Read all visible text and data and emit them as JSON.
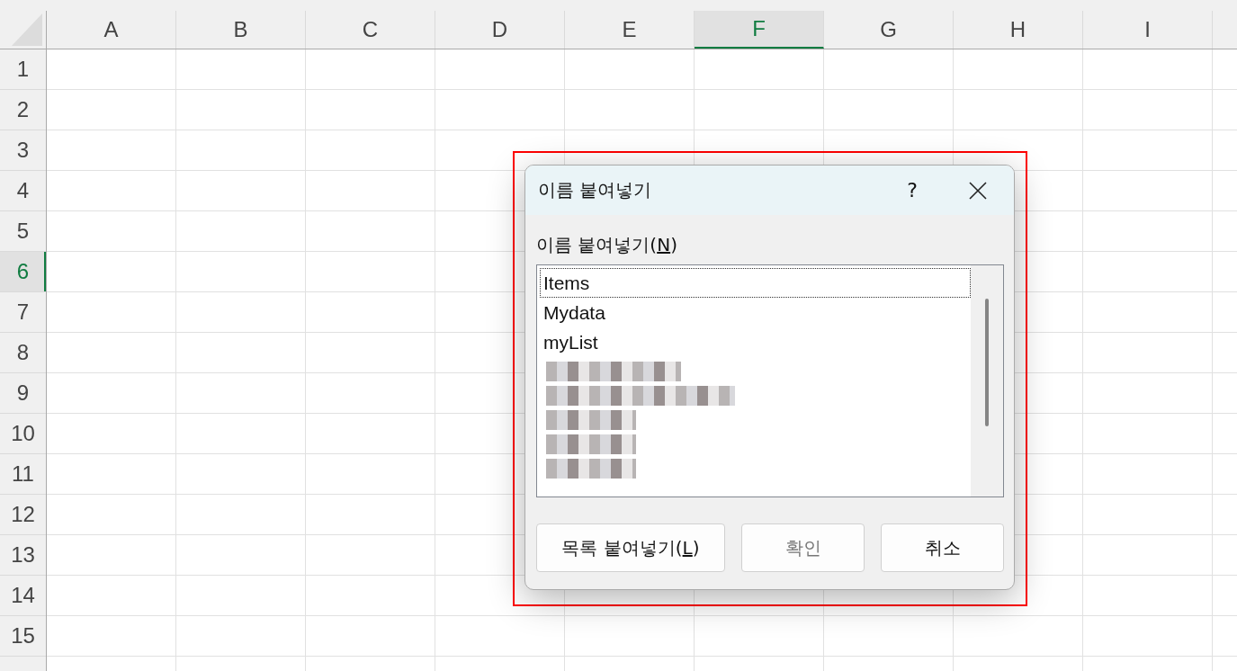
{
  "sheet": {
    "columns": [
      {
        "label": "A",
        "selected": false
      },
      {
        "label": "B",
        "selected": false
      },
      {
        "label": "C",
        "selected": false
      },
      {
        "label": "D",
        "selected": false
      },
      {
        "label": "E",
        "selected": false
      },
      {
        "label": "F",
        "selected": true
      },
      {
        "label": "G",
        "selected": false
      },
      {
        "label": "H",
        "selected": false
      },
      {
        "label": "I",
        "selected": false
      }
    ],
    "rows": [
      {
        "label": "1",
        "selected": false
      },
      {
        "label": "2",
        "selected": false
      },
      {
        "label": "3",
        "selected": false
      },
      {
        "label": "4",
        "selected": false
      },
      {
        "label": "5",
        "selected": false
      },
      {
        "label": "6",
        "selected": true
      },
      {
        "label": "7",
        "selected": false
      },
      {
        "label": "8",
        "selected": false
      },
      {
        "label": "9",
        "selected": false
      },
      {
        "label": "10",
        "selected": false
      },
      {
        "label": "11",
        "selected": false
      },
      {
        "label": "12",
        "selected": false
      },
      {
        "label": "13",
        "selected": false
      },
      {
        "label": "14",
        "selected": false
      },
      {
        "label": "15",
        "selected": false
      }
    ]
  },
  "dialog": {
    "title": "이름 붙여넣기",
    "help": "?",
    "list_label": {
      "before": "이름 붙여넣기(",
      "mnemonic": "N",
      "after": ")"
    },
    "names": [
      {
        "kind": "text",
        "label": "Items",
        "selected": true
      },
      {
        "kind": "text",
        "label": "Mydata",
        "selected": false
      },
      {
        "kind": "text",
        "label": "myList",
        "selected": false
      },
      {
        "kind": "redacted"
      },
      {
        "kind": "redacted"
      },
      {
        "kind": "redacted"
      },
      {
        "kind": "redacted"
      },
      {
        "kind": "redacted"
      }
    ],
    "buttons": [
      {
        "before": "목록 붙여넣기(",
        "mnemonic": "L",
        "after": ")",
        "disabled": false
      },
      {
        "before": "확인",
        "disabled": true
      },
      {
        "before": "취소",
        "disabled": false
      }
    ]
  }
}
